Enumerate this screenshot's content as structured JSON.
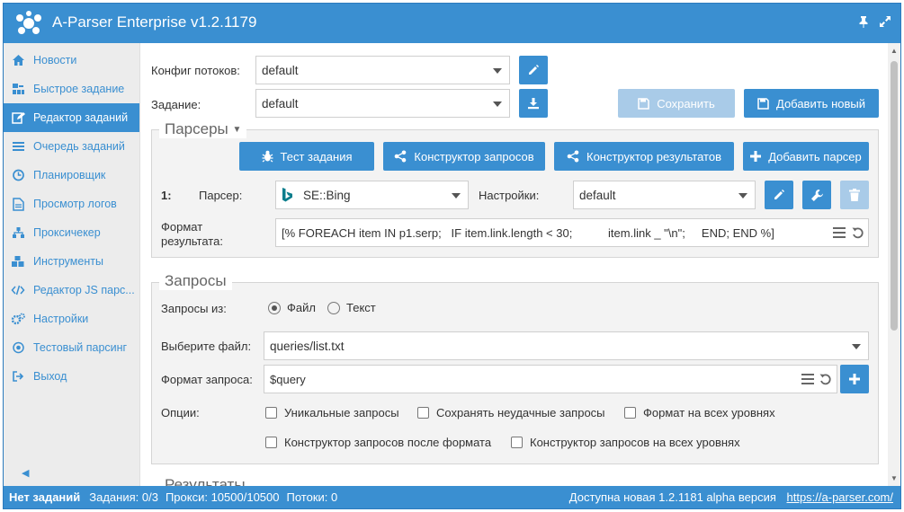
{
  "app": {
    "title": "A-Parser Enterprise v1.2.1179"
  },
  "sidebar": {
    "items": [
      {
        "label": "Новости",
        "icon": "home-icon"
      },
      {
        "label": "Быстрое задание",
        "icon": "sitemap-icon"
      },
      {
        "label": "Редактор заданий",
        "icon": "edit-icon",
        "active": true
      },
      {
        "label": "Очередь заданий",
        "icon": "list-icon"
      },
      {
        "label": "Планировщик",
        "icon": "clock-icon"
      },
      {
        "label": "Просмотр логов",
        "icon": "file-icon"
      },
      {
        "label": "Проксичекер",
        "icon": "network-icon"
      },
      {
        "label": "Инструменты",
        "icon": "cubes-icon"
      },
      {
        "label": "Редактор JS парс...",
        "icon": "code-icon"
      },
      {
        "label": "Настройки",
        "icon": "cogs-icon"
      },
      {
        "label": "Тестовый парсинг",
        "icon": "target-icon"
      },
      {
        "label": "Выход",
        "icon": "sign-out-icon"
      }
    ]
  },
  "form": {
    "threads_label": "Конфиг потоков:",
    "threads_value": "default",
    "task_label": "Задание:",
    "task_value": "default",
    "save_label": "Сохранить",
    "add_new_label": "Добавить новый"
  },
  "parsers": {
    "legend": "Парсеры",
    "test_task": "Тест задания",
    "query_builder": "Конструктор запросов",
    "result_builder": "Конструктор результатов",
    "add_parser": "Добавить парсер",
    "row_number": "1:",
    "parser_label": "Парсер:",
    "parser_value": "SE::Bing",
    "settings_label": "Настройки:",
    "settings_value": "default",
    "result_format_label": "Формат результата:",
    "result_format_value": "[% FOREACH item IN p1.serp;   IF item.link.length < 30;           item.link _ \"\\n\";     END; END %]"
  },
  "queries": {
    "legend": "Запросы",
    "from_label": "Запросы из:",
    "option_file": "Файл",
    "option_text": "Текст",
    "selected": "file",
    "choose_file_label": "Выберите файл:",
    "file_value": "queries/list.txt",
    "query_format_label": "Формат запроса:",
    "query_format_value": "$query",
    "options_label": "Опции:",
    "options": [
      "Уникальные запросы",
      "Сохранять неудачные запросы",
      "Формат на всех уровнях",
      "Конструктор запросов после формата",
      "Конструктор запросов на всех уровнях"
    ]
  },
  "results": {
    "legend": "Результаты"
  },
  "status": {
    "no_tasks": "Нет заданий",
    "tasks": "Задания: 0/3",
    "proxies": "Прокси: 10500/10500",
    "threads": "Потоки: 0",
    "update_text": "Доступна новая 1.2.1181 alpha версия",
    "link": "https://a-parser.com/"
  },
  "colors": {
    "accent": "#3a8fd1",
    "accent_disabled": "#a9cbe8",
    "bing": "#0a7d8c"
  }
}
